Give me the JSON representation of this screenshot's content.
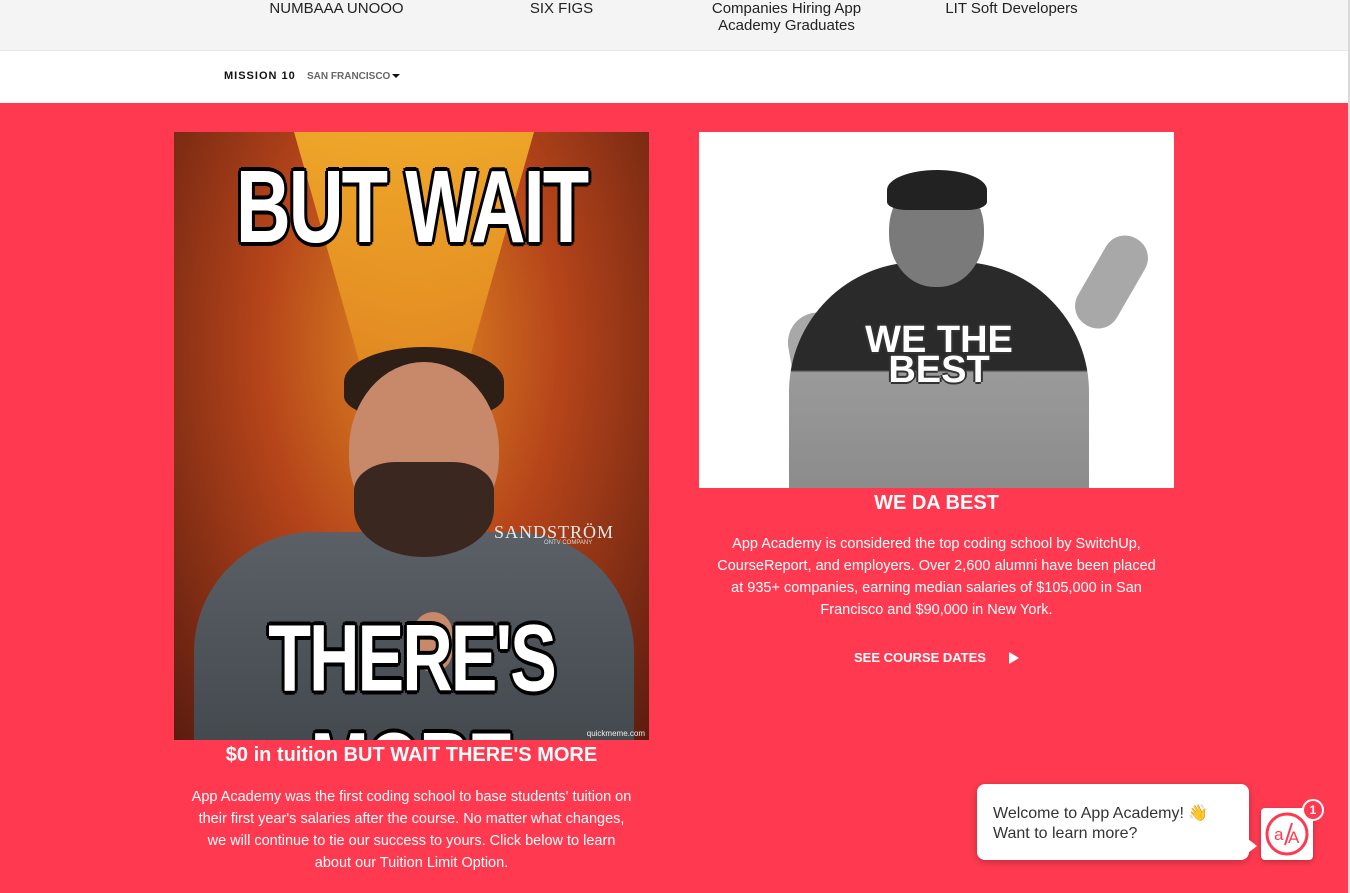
{
  "top_stats": [
    {
      "lines": [
        "NUMBAAA UNOOO"
      ]
    },
    {
      "lines": [
        "SIX FIGS"
      ]
    },
    {
      "lines": [
        "Companies Hiring App",
        "Academy Graduates"
      ]
    },
    {
      "lines": [
        "LIT Soft Developers"
      ]
    }
  ],
  "subnav": {
    "mission": "MISSION 10",
    "city": "SAN FRANCISCO"
  },
  "meme_left": {
    "top_text": "BUT WAIT",
    "bottom_text": "THERE'S MORE",
    "brand": "SANDSTRÖM",
    "brand_sub": "ONTV COMPANY",
    "watermark": "quickmeme.com"
  },
  "meme_right": {
    "overlay_text": "WE THE BEST"
  },
  "card_left": {
    "title": "$0 in tuition BUT WAIT THERE'S MORE",
    "body": "App Academy was the first coding school to base students' tuition on their first year's salaries after the course. No matter what changes, we will continue to tie our success to yours. Click below to learn about our Tuition Limit Option."
  },
  "card_right": {
    "title": "WE DA BEST",
    "body": "App Academy is considered the top coding school by SwitchUp, CourseReport, and employers. Over 2,600 alumni have been placed at 935+ companies, earning median salaries of $105,000 in San Francisco and $90,000 in New York.",
    "cta": "SEE COURSE DATES"
  },
  "chat": {
    "greeting": "Welcome to App Academy! 👋",
    "prompt": "Want to learn more?",
    "badge": "1"
  },
  "colors": {
    "brand_red": "#ff3a50",
    "white": "#ffffff"
  },
  "icons": [
    "caret-down-icon",
    "play-arrow-icon",
    "app-academy-logo-icon"
  ]
}
